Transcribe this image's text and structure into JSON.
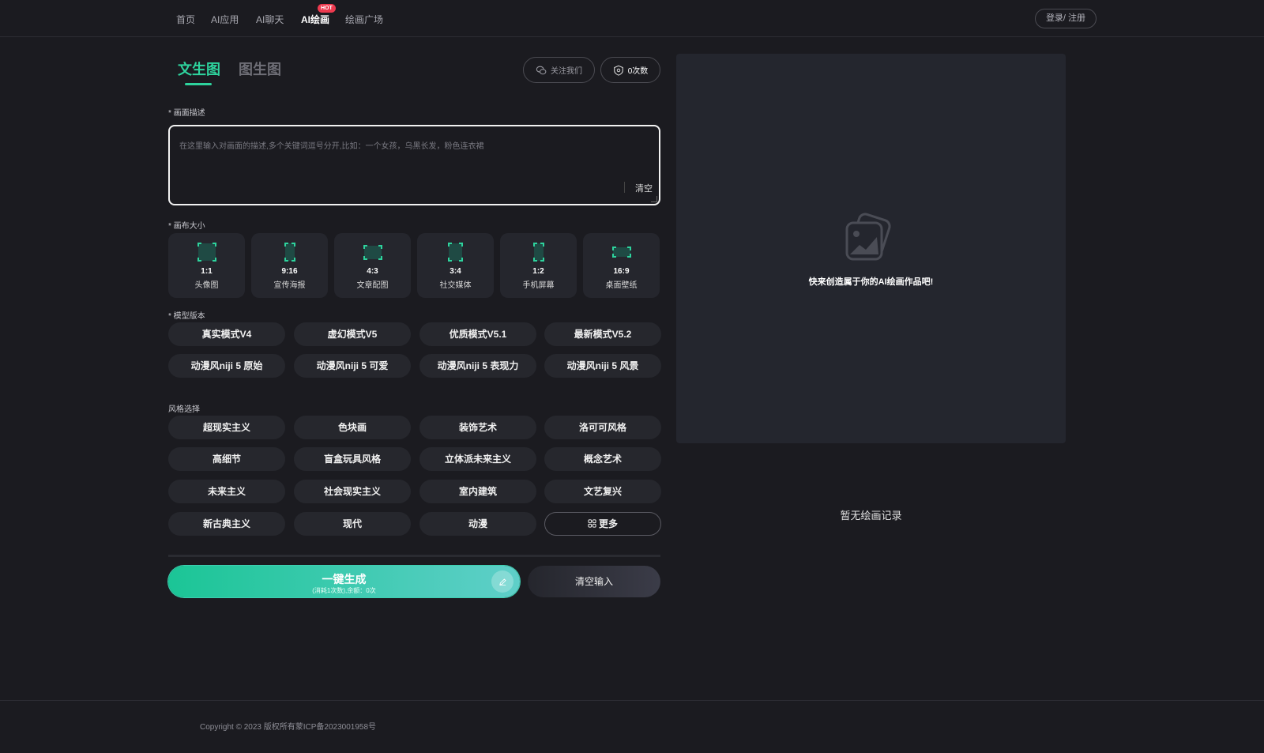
{
  "nav": {
    "items": [
      {
        "label": "首页"
      },
      {
        "label": "AI应用"
      },
      {
        "label": "AI聊天"
      },
      {
        "label": "AI绘画",
        "badge": "HOT"
      },
      {
        "label": "绘画广场"
      }
    ],
    "login_label": "登录/ 注册"
  },
  "tabs": {
    "text_to_image": "文生图",
    "image_to_image": "图生图"
  },
  "header_buttons": {
    "follow_label": "关注我们",
    "credits_label": "0次数"
  },
  "prompt": {
    "label": "* 画面描述",
    "placeholder": "在这里输入对画面的描述,多个关键词逗号分开,比如：一个女孩，乌黑长发，粉色连衣裙",
    "value": "",
    "clear_label": "清空"
  },
  "canvas": {
    "label": "* 画布大小",
    "sizes": [
      {
        "ratio": "1:1",
        "use": "头像图"
      },
      {
        "ratio": "9:16",
        "use": "宣传海报"
      },
      {
        "ratio": "4:3",
        "use": "文章配图"
      },
      {
        "ratio": "3:4",
        "use": "社交媒体"
      },
      {
        "ratio": "1:2",
        "use": "手机屏幕"
      },
      {
        "ratio": "16:9",
        "use": "桌面壁纸"
      }
    ]
  },
  "models": {
    "label": "* 模型版本",
    "items": [
      "真实模式V4",
      "虚幻模式V5",
      "优质模式V5.1",
      "最新模式V5.2",
      "动漫风niji 5 原始",
      "动漫风niji 5 可爱",
      "动漫风niji 5 表现力",
      "动漫风niji 5 风景"
    ]
  },
  "styles": {
    "label": "风格选择",
    "items": [
      "超现实主义",
      "色块画",
      "装饰艺术",
      "洛可可风格",
      "高细节",
      "盲盒玩具风格",
      "立体派未来主义",
      "概念艺术",
      "未来主义",
      "社会现实主义",
      "室内建筑",
      "文艺复兴",
      "新古典主义",
      "现代",
      "动漫"
    ],
    "more_label": "更多"
  },
  "actions": {
    "generate_label": "一键生成",
    "generate_sub": "(消耗1次数),余额：0次",
    "clear_input_label": "清空输入"
  },
  "preview": {
    "empty_text": "快来创造属于你的AI绘画作品吧!",
    "no_record": "暂无绘画记录"
  },
  "footer": {
    "copyright": "Copyright © 2023 版权所有蒙ICP备2023001958号"
  },
  "colors": {
    "accent": "#2ed39d",
    "hot_badge": "#ee3a4f",
    "background": "#1b1b20",
    "panel": "#24262e"
  }
}
